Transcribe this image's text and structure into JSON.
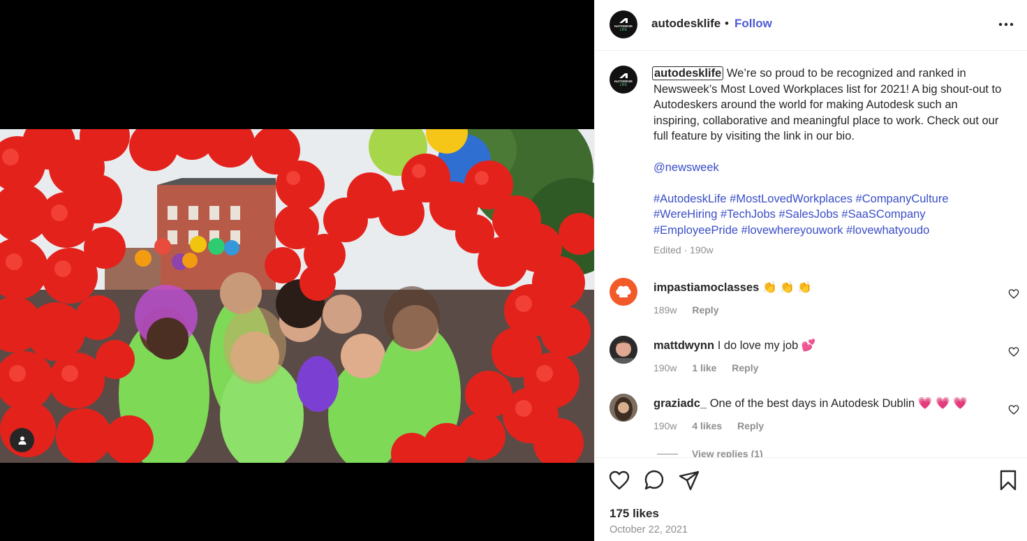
{
  "post": {
    "username": "autodesklife",
    "follow_label": "Follow",
    "separator": "•",
    "avatar": {
      "brand_text": "AUTODESK",
      "sub_text": "LIFE"
    }
  },
  "caption": {
    "username": "autodesklife",
    "text": "We’re so proud to be recognized and ranked in Newsweek’s Most Loved Workplaces list for 2021! A big shout-out to Autodeskers around the world for making Autodesk such an inspiring, collaborative and meaningful place to work. Check out our full feature by visiting the link in our bio.",
    "mention": "@newsweek",
    "hashtags": [
      "#AutodeskLife",
      "#MostLovedWorkplaces",
      "#CompanyCulture",
      "#WereHiring",
      "#TechJobs",
      "#SalesJobs",
      "#SaaSCompany",
      "#EmployeePride",
      "#lovewhereyouwork",
      "#lovewhatyoudo"
    ],
    "meta": "Edited · 190w"
  },
  "comments": [
    {
      "username": "impastiamoclasses",
      "text": "👏 👏 👏",
      "time": "189w",
      "likes": "",
      "reply_label": "Reply"
    },
    {
      "username": "mattdwynn",
      "text": "I do love my job 💕",
      "time": "190w",
      "likes": "1 like",
      "reply_label": "Reply"
    },
    {
      "username": "graziadc_",
      "text": "One of the best days in Autodesk Dublin 💗 💗 💗",
      "time": "190w",
      "likes": "4 likes",
      "reply_label": "Reply"
    }
  ],
  "view_replies": "View replies (1)",
  "likes_count": "175 likes",
  "date": "October 22, 2021",
  "colors": {
    "link": "#3a4ec7",
    "follow": "#4f5bd5",
    "muted": "#8e8e8e",
    "text": "#262626"
  },
  "icons": [
    "user-tag-icon",
    "more-options-icon",
    "heart-icon",
    "comment-icon",
    "share-icon",
    "bookmark-icon"
  ]
}
